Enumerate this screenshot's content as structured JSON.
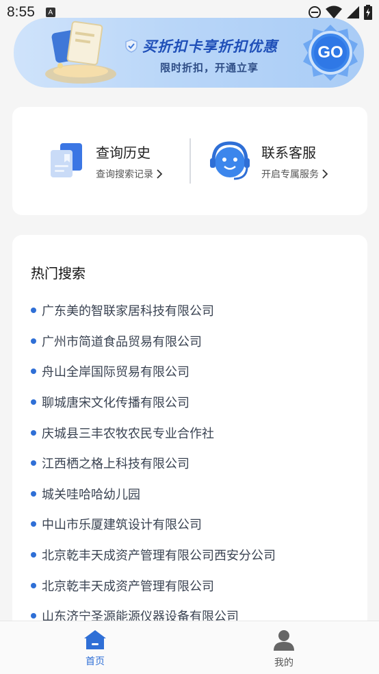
{
  "status_bar": {
    "time": "8:55",
    "badge": "A",
    "icons": [
      "dnd-icon",
      "wifi-icon",
      "signal-icon",
      "battery-charging-icon"
    ]
  },
  "banner": {
    "title": "买折扣卡享折扣优惠",
    "subtitle": "限时折扣，开通立享",
    "button_label": "GO"
  },
  "quick": {
    "history": {
      "title": "查询历史",
      "subtitle": "查询搜索记录",
      "icon": "document-icon"
    },
    "service": {
      "title": "联系客服",
      "subtitle": "开启专属服务",
      "icon": "customer-service-icon"
    }
  },
  "hot": {
    "title": "热门搜索",
    "items": [
      "广东美的智联家居科技有限公司",
      "广州市简道食品贸易有限公司",
      "舟山全岸国际贸易有限公司",
      "聊城唐宋文化传播有限公司",
      "庆城县三丰农牧农民专业合作社",
      "江西栖之格上科技有限公司",
      "城关哇哈哈幼儿园",
      "中山市乐厦建筑设计有限公司",
      "北京乾丰天成资产管理有限公司西安分公司",
      "北京乾丰天成资产管理有限公司",
      "山东济宁圣源能源仪器设备有限公司"
    ]
  },
  "tabs": {
    "home": {
      "label": "首页",
      "icon": "home-icon"
    },
    "mine": {
      "label": "我的",
      "icon": "user-icon"
    }
  },
  "colors": {
    "accent": "#2f6fd6",
    "banner_text": "#1f4fb8",
    "background": "#f5f5f5"
  }
}
